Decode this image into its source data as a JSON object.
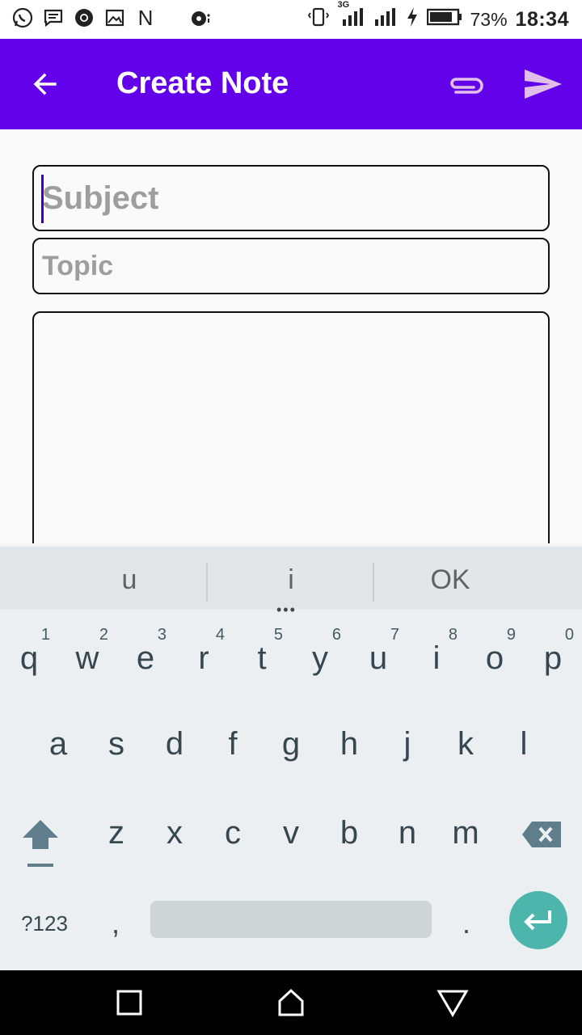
{
  "status_bar": {
    "left_icons": [
      "whatsapp-icon",
      "message-icon",
      "chrome-icon",
      "gallery-icon",
      "n-icon",
      "music-icon"
    ],
    "n_letter": "N",
    "network_label": "3G",
    "battery_percent": "73%",
    "time": "18:34"
  },
  "appbar": {
    "title": "Create Note",
    "back_icon": "arrow-back-icon",
    "attach_icon": "paperclip-icon",
    "send_icon": "send-icon",
    "color": "#6200ea"
  },
  "form": {
    "subject_placeholder": "Subject",
    "subject_value": "",
    "topic_placeholder": "Topic",
    "topic_value": "",
    "body_value": ""
  },
  "keyboard": {
    "suggestions": [
      "u",
      "i",
      "OK"
    ],
    "row1": [
      {
        "key": "q",
        "hint": "1"
      },
      {
        "key": "w",
        "hint": "2"
      },
      {
        "key": "e",
        "hint": "3"
      },
      {
        "key": "r",
        "hint": "4"
      },
      {
        "key": "t",
        "hint": "5"
      },
      {
        "key": "y",
        "hint": "6"
      },
      {
        "key": "u",
        "hint": "7"
      },
      {
        "key": "i",
        "hint": "8"
      },
      {
        "key": "o",
        "hint": "9"
      },
      {
        "key": "p",
        "hint": "0"
      }
    ],
    "row2": [
      "a",
      "s",
      "d",
      "f",
      "g",
      "h",
      "j",
      "k",
      "l"
    ],
    "row3": [
      "z",
      "x",
      "c",
      "v",
      "b",
      "n",
      "m"
    ],
    "symbols_label": "?123",
    "comma_label": ",",
    "period_label": ".",
    "accent": "#4db6ac"
  },
  "navbar": {
    "items": [
      "recent-apps-icon",
      "home-icon",
      "back-icon"
    ]
  }
}
